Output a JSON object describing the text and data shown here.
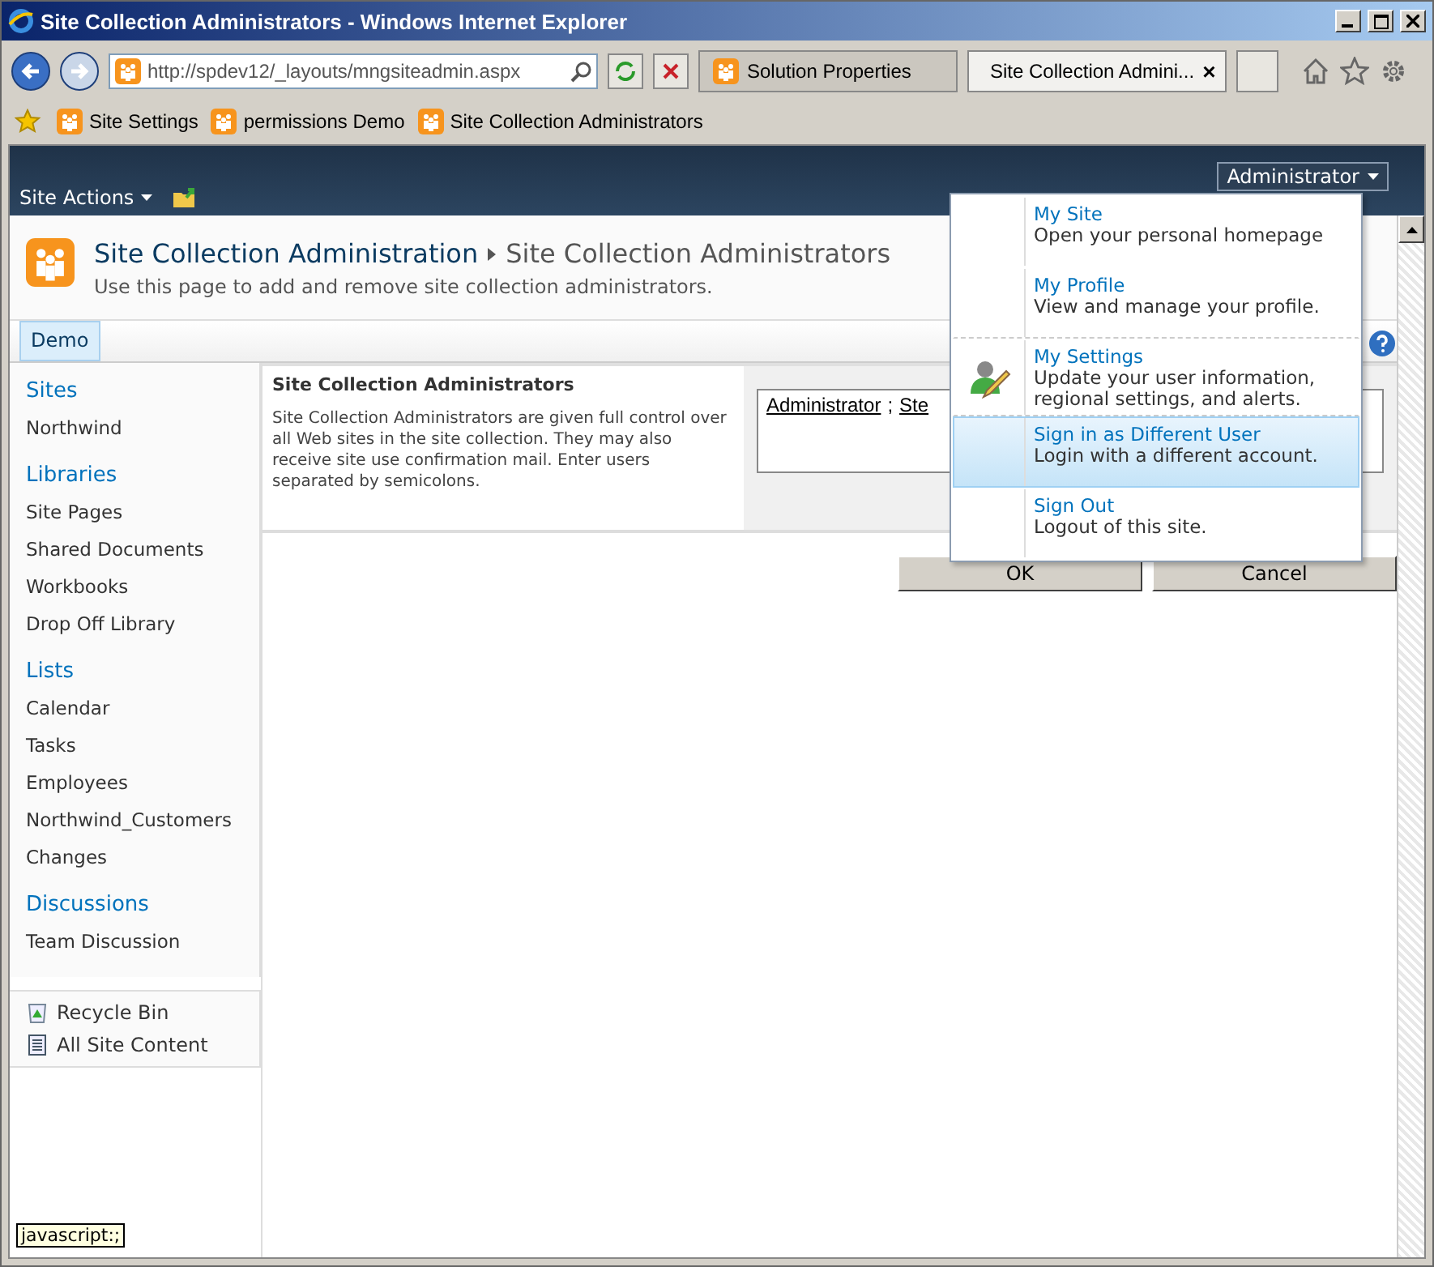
{
  "window": {
    "title": "Site Collection Administrators - Windows Internet Explorer"
  },
  "address": {
    "value": "http://spdev12/_layouts/mngsiteadmin.aspx"
  },
  "tabs": [
    {
      "label": "Solution Properties",
      "selected": false
    },
    {
      "label": "Site Collection Admini...",
      "selected": true,
      "close": "×"
    }
  ],
  "favorites": [
    "Site Settings",
    "permissions Demo",
    "Site Collection Administrators"
  ],
  "ribbon": {
    "site_actions": "Site Actions",
    "user": "Administrator"
  },
  "header": {
    "parent": "Site Collection Administration",
    "title": "Site Collection Administrators",
    "description": "Use this page to add and remove site collection administrators."
  },
  "top_nav": [
    {
      "label": "Demo",
      "selected": true
    }
  ],
  "quick_launch": [
    {
      "heading": "Sites",
      "items": [
        "Northwind"
      ]
    },
    {
      "heading": "Libraries",
      "items": [
        "Site Pages",
        "Shared Documents",
        "Workbooks",
        "Drop Off Library"
      ]
    },
    {
      "heading": "Lists",
      "items": [
        "Calendar",
        "Tasks",
        "Employees",
        "Northwind_Customers",
        "Changes"
      ]
    },
    {
      "heading": "Discussions",
      "items": [
        "Team Discussion"
      ]
    }
  ],
  "bottom_links": [
    {
      "kind": "recycle",
      "label": "Recycle Bin"
    },
    {
      "kind": "content",
      "label": "All Site Content"
    }
  ],
  "section": {
    "title": "Site Collection Administrators",
    "description": "Site Collection Administrators are given full control over all Web sites in the site collection. They may also receive site use confirmation mail. Enter users separated by semicolons.",
    "users": [
      "Administrator",
      "Ste"
    ],
    "separator": ";"
  },
  "buttons": [
    "OK",
    "Cancel"
  ],
  "user_menu": [
    {
      "title": "My Site",
      "description": "Open your personal homepage",
      "selected": false,
      "icon": false,
      "divider": false
    },
    {
      "title": "My Profile",
      "description": "View and manage your profile.",
      "selected": false,
      "icon": false,
      "divider": true
    },
    {
      "title": "My Settings",
      "description": "Update your user information, regional settings, and alerts.",
      "selected": false,
      "icon": true,
      "divider": true
    },
    {
      "title": "Sign in as Different User",
      "description": "Login with a different account.",
      "selected": true,
      "icon": false,
      "divider": false
    },
    {
      "title": "Sign Out",
      "description": "Logout of this site.",
      "selected": false,
      "icon": false,
      "divider": false
    }
  ],
  "status_tooltip": "javascript:;"
}
